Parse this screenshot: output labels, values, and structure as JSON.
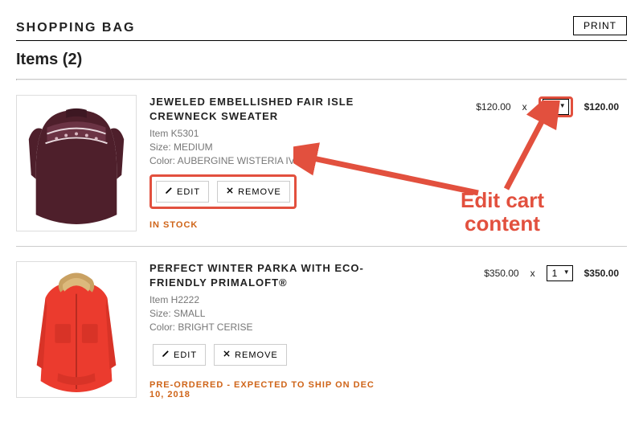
{
  "header": {
    "title": "SHOPPING BAG",
    "print_label": "PRINT",
    "items_heading": "Items (2)"
  },
  "items": [
    {
      "name": "JEWELED EMBELLISHED FAIR ISLE CREWNECK SWEATER",
      "item_code": "Item K5301",
      "size": "Size: MEDIUM",
      "color": "Color: AUBERGINE WISTERIA IVORY",
      "edit_label": "EDIT",
      "remove_label": "REMOVE",
      "stock_status": "IN STOCK",
      "unit_price": "$120.00",
      "mult": "x",
      "qty_value": "1",
      "line_total": "$120.00"
    },
    {
      "name": "PERFECT WINTER PARKA WITH ECO-FRIENDLY PRIMALOFT®",
      "item_code": "Item H2222",
      "size": "Size: SMALL",
      "color": "Color: BRIGHT CERISE",
      "edit_label": "EDIT",
      "remove_label": "REMOVE",
      "stock_status": "PRE-ORDERED - EXPECTED TO SHIP ON DEC 10, 2018",
      "unit_price": "$350.00",
      "mult": "x",
      "qty_value": "1",
      "line_total": "$350.00"
    }
  ],
  "annotation": {
    "label": "Edit cart content"
  }
}
